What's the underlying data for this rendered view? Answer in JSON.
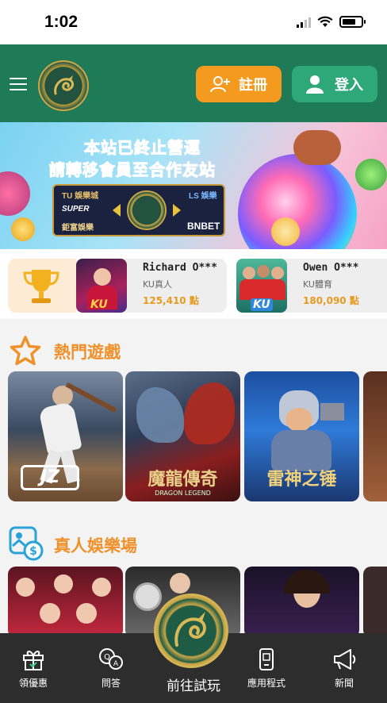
{
  "status_bar": {
    "time": "1:02"
  },
  "header": {
    "register_label": "註冊",
    "login_label": "登入"
  },
  "banner": {
    "line1": "本站已終止營運",
    "line2": "請轉移會員至合作友站",
    "partners": [
      "TU 娛樂城",
      "SUPER",
      "鉅富娛樂",
      "LS 娛樂",
      "BNBET"
    ]
  },
  "winners": [
    {
      "name": "Richard O***",
      "category": "KU真人",
      "amount": "125,410 點",
      "badge": "KU"
    },
    {
      "name": "Owen O***",
      "category": "KU體育",
      "amount": "180,090 點",
      "badge": "KU"
    }
  ],
  "sections": {
    "hot_games": {
      "title": "熱門遊戲",
      "games": [
        {
          "name": "JZ",
          "subtitle": ""
        },
        {
          "name": "魔龍傳奇",
          "subtitle": "DRAGON LEGEND"
        },
        {
          "name": "雷神之锤",
          "subtitle": ""
        }
      ]
    },
    "live_casino": {
      "title": "真人娛樂場"
    }
  },
  "bottom_nav": {
    "items": [
      {
        "label": "領優惠",
        "icon": "gift-icon"
      },
      {
        "label": "問答",
        "icon": "qa-icon"
      },
      {
        "label": "應用程式",
        "icon": "phone-app-icon"
      },
      {
        "label": "新聞",
        "icon": "megaphone-icon"
      }
    ],
    "center_label": "前往試玩"
  },
  "colors": {
    "header_green": "#1f7a58",
    "register_orange": "#f39a1f",
    "login_green": "#2ea878",
    "accent_orange": "#f0902a",
    "nav_bg": "#2d2d2d"
  }
}
